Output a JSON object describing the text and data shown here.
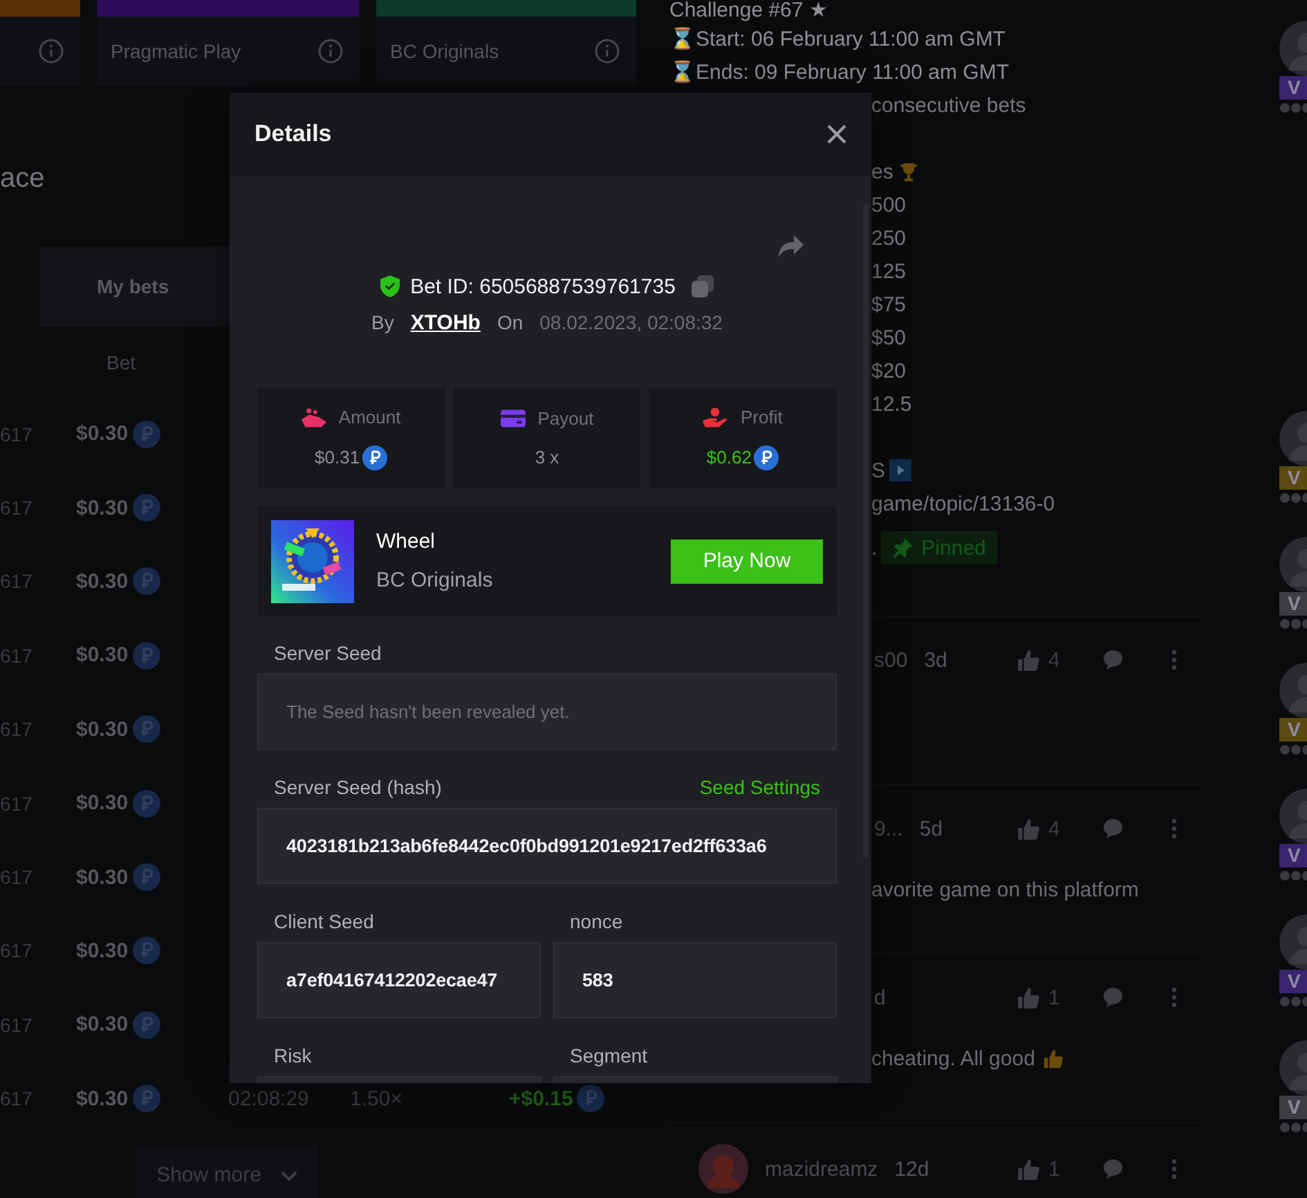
{
  "provider_cards": [
    {
      "color": "#5a3208"
    },
    {
      "name": "Pragmatic Play",
      "color": "#2d0a5a"
    },
    {
      "name": "BC Originals",
      "color": "#0c3a2a"
    }
  ],
  "race_title": "ace",
  "bet_tabs": [
    {
      "label": "My bets",
      "selected": true
    }
  ],
  "bet_columns": [
    "Bet"
  ],
  "bets": [
    {
      "id": "617",
      "amount": "$0.30"
    },
    {
      "id": "617",
      "amount": "$0.30"
    },
    {
      "id": "617",
      "amount": "$0.30"
    },
    {
      "id": "617",
      "amount": "$0.30"
    },
    {
      "id": "617",
      "amount": "$0.30"
    },
    {
      "id": "617",
      "amount": "$0.30"
    },
    {
      "id": "617",
      "amount": "$0.30"
    },
    {
      "id": "617",
      "amount": "$0.30"
    },
    {
      "id": "617",
      "amount": "$0.30"
    },
    {
      "id": "617",
      "amount": "$0.30",
      "time": "02:08:29",
      "payout": "1.50×",
      "profit": "+$0.15"
    }
  ],
  "show_more": "Show more",
  "post": {
    "lines": [
      {
        "kind": "full",
        "text": "Challenge #67 ★"
      },
      {
        "kind": "full",
        "text": "⌛Start: 06 February 11:00 am GMT"
      },
      {
        "kind": "full",
        "text": "⌛Ends: 09 February 11:00 am GMT"
      },
      {
        "kind": "cut",
        "text": "consecutive bets"
      },
      {
        "kind": "blank"
      },
      {
        "kind": "cut-trophy",
        "text": "es"
      },
      {
        "kind": "cut",
        "text": "500"
      },
      {
        "kind": "cut",
        "text": "250"
      },
      {
        "kind": "cut",
        "text": "125"
      },
      {
        "kind": "cut",
        "text": "$75"
      },
      {
        "kind": "cut",
        "text": "$50"
      },
      {
        "kind": "cut",
        "text": "$20"
      },
      {
        "kind": "cut",
        "text": "12.5"
      },
      {
        "kind": "blank"
      },
      {
        "kind": "cut-play",
        "text": "S"
      },
      {
        "kind": "cut",
        "text": "game/topic/13136-0"
      },
      {
        "kind": "cut",
        "text": ".",
        "badge": "Pinned"
      }
    ]
  },
  "comments": [
    {
      "author": "s00",
      "age": "3d",
      "likes": "4"
    },
    {
      "author": "9...",
      "age": "5d",
      "likes": "4",
      "text": "avorite game on this platform"
    },
    {
      "age": "d",
      "likes": "1",
      "text": "cheating. All good",
      "thumb": true
    },
    {
      "avatar": true,
      "author": "mazidreamz",
      "age": "12d",
      "likes": "1"
    }
  ],
  "vip": [
    {
      "badge": "V",
      "color": "#3a2470"
    },
    {
      "badge": "V",
      "color": "#5a4a10"
    },
    {
      "badge": "V",
      "color": "#3c3e44"
    },
    {
      "badge": "V",
      "color": "#5a4a10"
    },
    {
      "badge": "V",
      "color": "#3a2470"
    },
    {
      "badge": "V",
      "color": "#3a2470"
    },
    {
      "badge": "V",
      "color": "#3c3e44"
    }
  ],
  "modal": {
    "title": "Details",
    "bet_id": "Bet ID: 65056887539761735",
    "by_label": "By",
    "user": "XTOHb",
    "on_label": "On",
    "date": "08.02.2023, 02:08:32",
    "stats": [
      {
        "kind": "amount",
        "label": "Amount",
        "value": "$0.31",
        "coin": true,
        "positive": false
      },
      {
        "kind": "payout",
        "label": "Payout",
        "value": "3 x",
        "coin": false,
        "positive": false
      },
      {
        "kind": "profit",
        "label": "Profit",
        "value": "$0.62",
        "coin": true,
        "positive": true
      }
    ],
    "game": {
      "name": "Wheel",
      "provider": "BC Originals",
      "action": "Play Now"
    },
    "field_rows": [
      {
        "fields": [
          {
            "label": "Server Seed",
            "kind": "message",
            "text": "The Seed hasn't been revealed yet."
          }
        ]
      },
      {
        "fields": [
          {
            "label": "Server Seed (hash)",
            "link": "Seed Settings",
            "kind": "value",
            "text": "4023181b213ab6fe8442ec0f0bd991201e9217ed2ff633a6"
          }
        ]
      },
      {
        "fields": [
          {
            "label": "Client Seed",
            "kind": "value",
            "text": "a7ef04167412202ecae47"
          },
          {
            "label": "nonce",
            "kind": "value",
            "text": "583"
          }
        ]
      },
      {
        "fields": [
          {
            "label": "Risk",
            "kind": "value"
          },
          {
            "label": "Segment",
            "kind": "value"
          }
        ]
      }
    ]
  }
}
